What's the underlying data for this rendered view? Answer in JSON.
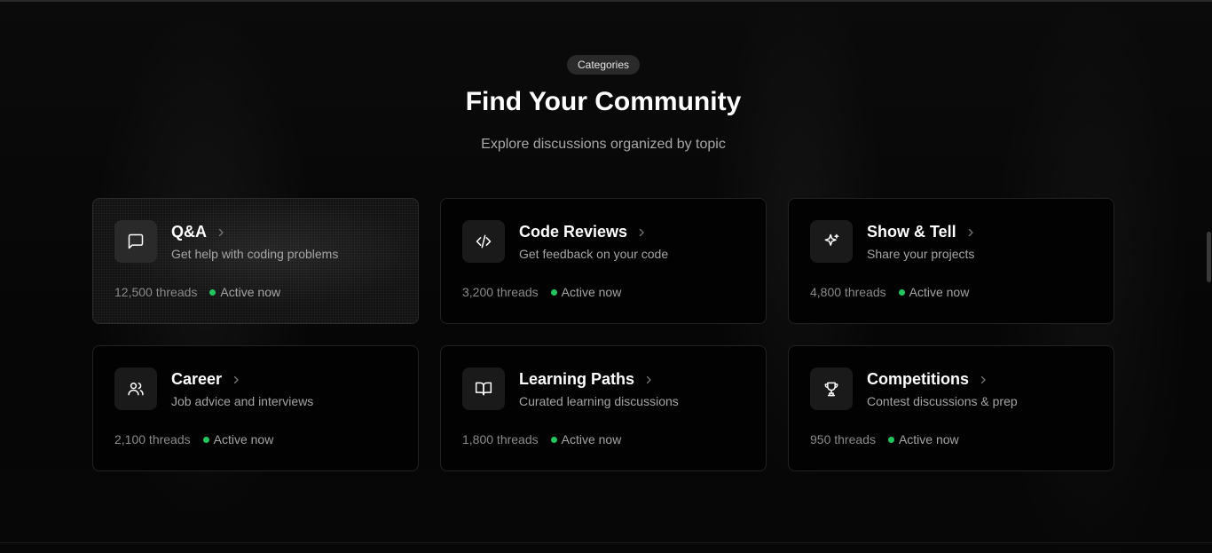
{
  "section": {
    "badge": "Categories",
    "title": "Find Your Community",
    "subtitle": "Explore discussions organized by topic"
  },
  "colors": {
    "active_dot": "#22c55e",
    "card_border": "#222222",
    "badge_bg": "#2a2a2a"
  },
  "categories": [
    {
      "title": "Q&A",
      "description": "Get help with coding problems",
      "threads": "12,500 threads",
      "status": "Active now",
      "icon": "message-square-icon"
    },
    {
      "title": "Code Reviews",
      "description": "Get feedback on your code",
      "threads": "3,200 threads",
      "status": "Active now",
      "icon": "code-icon"
    },
    {
      "title": "Show & Tell",
      "description": "Share your projects",
      "threads": "4,800 threads",
      "status": "Active now",
      "icon": "sparkles-icon"
    },
    {
      "title": "Career",
      "description": "Job advice and interviews",
      "threads": "2,100 threads",
      "status": "Active now",
      "icon": "users-icon"
    },
    {
      "title": "Learning Paths",
      "description": "Curated learning discussions",
      "threads": "1,800 threads",
      "status": "Active now",
      "icon": "book-open-icon"
    },
    {
      "title": "Competitions",
      "description": "Contest discussions & prep",
      "threads": "950 threads",
      "status": "Active now",
      "icon": "trophy-icon"
    }
  ]
}
